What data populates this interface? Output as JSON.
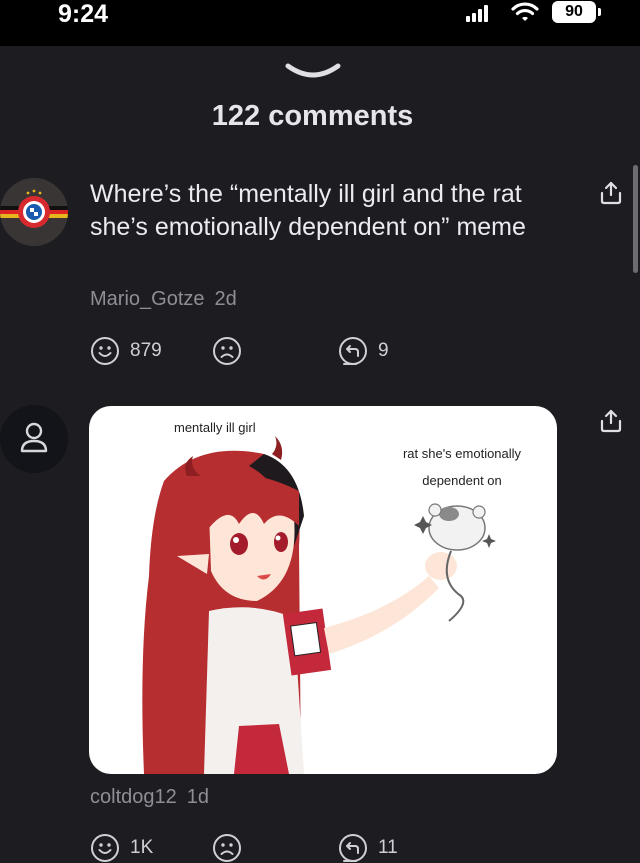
{
  "status_bar": {
    "time": "9:24",
    "battery": "90"
  },
  "header": {
    "comments_count": "122 comments"
  },
  "comments": [
    {
      "text": "Where’s the “mentally ill girl and the rat she’s emotionally dependent on” meme",
      "author": "Mario_Gotze",
      "time": "2d",
      "upvotes": "879",
      "replies": "9",
      "avatar_icon": "club-badge-icon"
    },
    {
      "author": "coltdog12",
      "time": "1d",
      "upvotes": "1K",
      "replies": "11",
      "avatar_icon": "user-icon",
      "image": {
        "caption_left": "mentally ill girl",
        "caption_right": "rat she's emotionally dependent on"
      }
    }
  ],
  "icons": {
    "upvote": "smile-icon",
    "downvote": "frown-icon",
    "reply": "reply-icon",
    "share": "share-icon"
  },
  "colors": {
    "background": "#1c1c21",
    "status_bar": "#000000",
    "meta_text": "#8e8e96"
  }
}
